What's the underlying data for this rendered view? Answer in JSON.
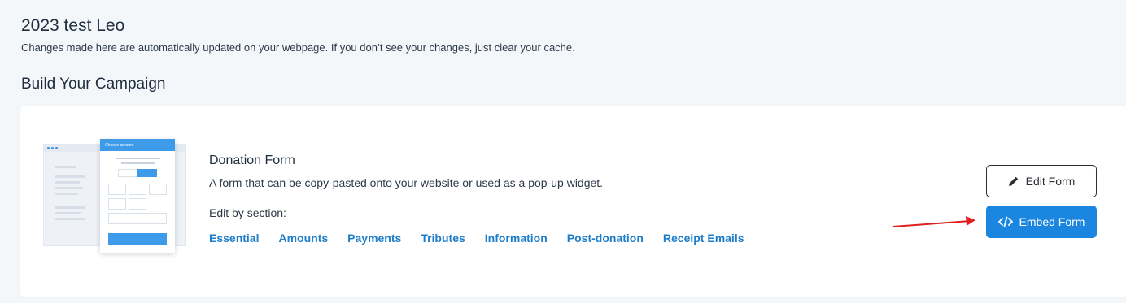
{
  "header": {
    "title": "2023 test Leo",
    "subtitle": "Changes made here are automatically updated on your webpage. If you don’t see your changes, just clear your cache."
  },
  "section": {
    "title": "Build Your Campaign"
  },
  "card": {
    "illustration": {
      "header_label": "Choose amount"
    },
    "title": "Donation Form",
    "description": "A form that can be copy-pasted onto your website or used as a pop-up widget.",
    "edit_by_label": "Edit by section:",
    "sections": [
      "Essential",
      "Amounts",
      "Payments",
      "Tributes",
      "Information",
      "Post-donation",
      "Receipt Emails"
    ],
    "edit_button": {
      "label": "Edit Form",
      "icon": "pencil-icon"
    },
    "embed_button": {
      "label": "Embed Form",
      "icon": "code-icon"
    }
  },
  "colors": {
    "accent": "#1a86e0",
    "link": "#1f7ec9",
    "annotation_arrow": "#e02020"
  }
}
